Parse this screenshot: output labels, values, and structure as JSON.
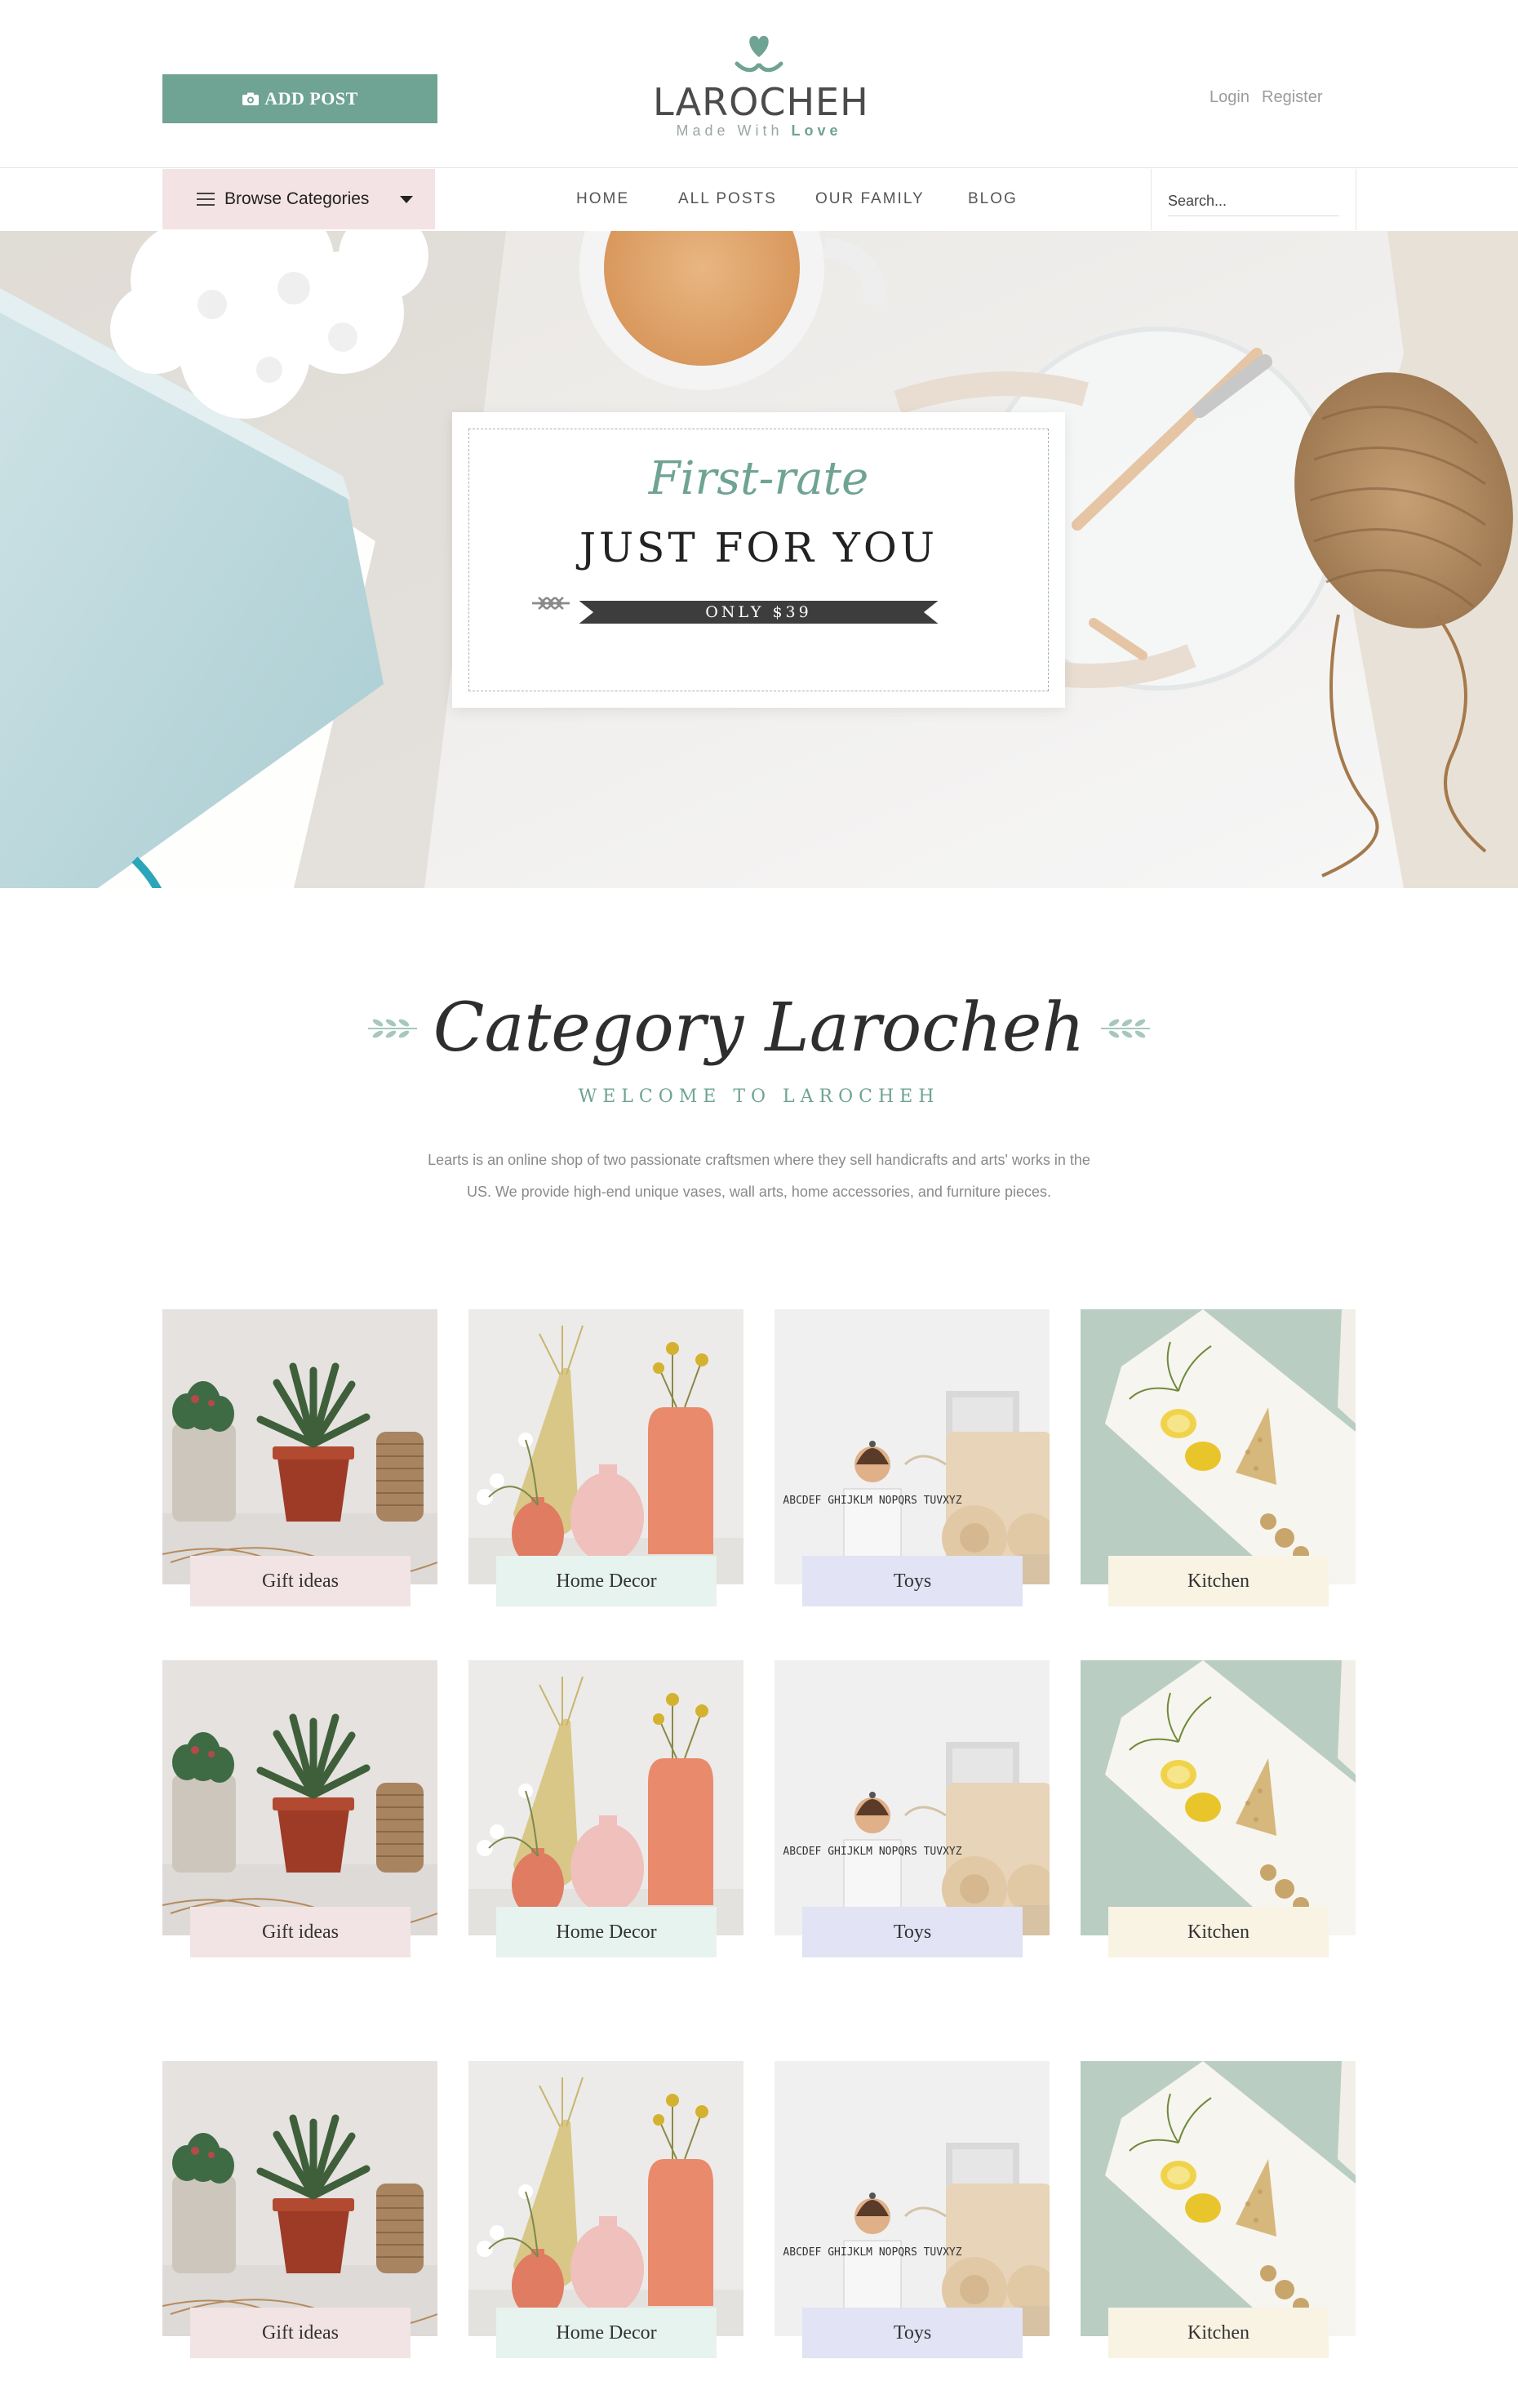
{
  "header": {
    "add_post_label": "ADD POST",
    "logo_name": "LAROCHEH",
    "logo_tagline_prefix": "Made With ",
    "logo_tagline_emphasis": "Love",
    "login_label": "Login",
    "register_label": "Register"
  },
  "nav": {
    "browse_label": "Browse Categories",
    "items": [
      {
        "label": "HOME"
      },
      {
        "label": "ALL POSTS"
      },
      {
        "label": "OUR FAMILY"
      },
      {
        "label": "BLOG"
      }
    ],
    "search_placeholder": "Search..."
  },
  "hero": {
    "script_text": "First-rate",
    "title": "JUST FOR YOU",
    "ribbon": "ONLY $39"
  },
  "category_section": {
    "title": "Category Larocheh",
    "subtitle": "WELCOME TO LAROCHEH",
    "description": "Learts is an online shop of two passionate craftsmen where they sell handicrafts and arts' works in the US. We provide high-end unique vases, wall arts, home accessories, and furniture pieces."
  },
  "grid_rows": [
    {
      "cards": [
        {
          "label": "Gift ideas",
          "color": "#f2e3e5",
          "image": "succulents"
        },
        {
          "label": "Home Decor",
          "color": "#e6f3ef",
          "image": "vases"
        },
        {
          "label": "Toys",
          "color": "#e2e3f4",
          "image": "toys"
        },
        {
          "label": "Kitchen",
          "color": "#f8f3e3",
          "image": "kitchen"
        }
      ]
    },
    {
      "cards": [
        {
          "label": "Gift ideas",
          "color": "#f2e3e5",
          "image": "succulents"
        },
        {
          "label": "Home Decor",
          "color": "#e6f3ef",
          "image": "vases"
        },
        {
          "label": "Toys",
          "color": "#e2e3f4",
          "image": "toys"
        },
        {
          "label": "Kitchen",
          "color": "#f8f3e3",
          "image": "kitchen"
        }
      ]
    },
    {
      "cards": [
        {
          "label": "Gift ideas",
          "color": "#f2e3e5",
          "image": "succulents"
        },
        {
          "label": "Home Decor",
          "color": "#e6f3ef",
          "image": "vases"
        },
        {
          "label": "Toys",
          "color": "#e2e3f4",
          "image": "toys"
        },
        {
          "label": "Kitchen",
          "color": "#f8f3e3",
          "image": "kitchen"
        }
      ]
    }
  ],
  "colors": {
    "accent": "#6fa394",
    "browse_bg": "#f3e3e5"
  },
  "toy_blocks_text": "ABCDEF GHIJKLM NOPQRS TUVXYZ"
}
